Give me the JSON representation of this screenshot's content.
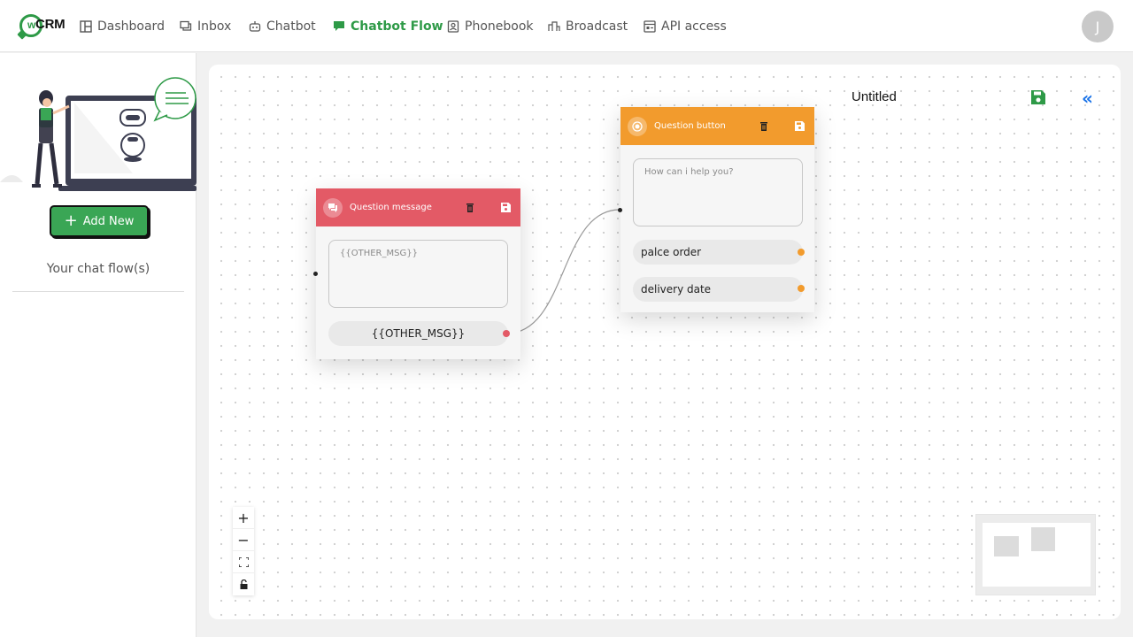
{
  "app": {
    "logo_text": "CRM",
    "logo_w": "w"
  },
  "nav": [
    {
      "label": "Dashboard",
      "icon": "dashboard-icon"
    },
    {
      "label": "Inbox",
      "icon": "inbox-icon"
    },
    {
      "label": "Chatbot",
      "icon": "chatbot-icon"
    },
    {
      "label": "Chatbot Flow",
      "icon": "flow-icon",
      "active": true
    },
    {
      "label": "Phonebook",
      "icon": "phonebook-icon"
    },
    {
      "label": "Broadcast",
      "icon": "broadcast-icon"
    },
    {
      "label": "API access",
      "icon": "api-icon"
    }
  ],
  "user": {
    "initial": "J"
  },
  "sidebar": {
    "add_new_label": "Add New",
    "flows_label": "Your chat flow(s)"
  },
  "canvas": {
    "title": "Untitled"
  },
  "nodes": {
    "question_message": {
      "title": "Question message",
      "textarea_value": "{{OTHER_MSG}}",
      "option": "{{OTHER_MSG}}"
    },
    "question_button": {
      "title": "Question button",
      "textarea_placeholder": "How can i help you?",
      "options": [
        "palce order",
        "delivery date"
      ]
    }
  },
  "controls": {
    "zoom_in": "+",
    "zoom_out": "−"
  },
  "colors": {
    "brand_green": "#2e9a47",
    "question_message_header": "#e35a66",
    "question_button_header": "#f29b2d",
    "link_blue": "#1a73e8"
  }
}
